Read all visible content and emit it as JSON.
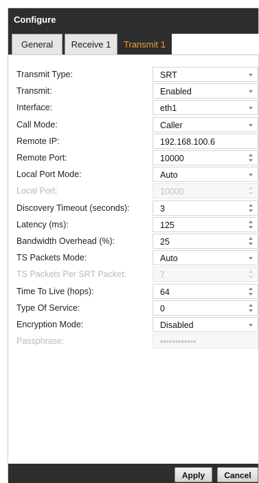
{
  "window": {
    "title": "Configure"
  },
  "tabs": [
    {
      "label": "General"
    },
    {
      "label": "Receive 1"
    },
    {
      "label": "Transmit 1",
      "active": true
    }
  ],
  "colors": {
    "active_tab": "#f39c2a",
    "chrome": "#2e2e2e"
  },
  "fields": [
    {
      "label": "Transmit Type:",
      "value": "SRT",
      "control": "dropdown",
      "disabled": false
    },
    {
      "label": "Transmit:",
      "value": "Enabled",
      "control": "dropdown",
      "disabled": false
    },
    {
      "label": "Interface:",
      "value": "eth1",
      "control": "dropdown",
      "disabled": false
    },
    {
      "label": "Call Mode:",
      "value": "Caller",
      "control": "dropdown",
      "disabled": false
    },
    {
      "label": "Remote IP:",
      "value": "192.168.100.6",
      "control": "text",
      "disabled": false
    },
    {
      "label": "Remote Port:",
      "value": "10000",
      "control": "spinner",
      "disabled": false
    },
    {
      "label": "Local Port Mode:",
      "value": "Auto",
      "control": "dropdown",
      "disabled": false
    },
    {
      "label": "Local Port:",
      "value": "10000",
      "control": "spinner",
      "disabled": true
    },
    {
      "label": "Discovery Timeout (seconds):",
      "value": "3",
      "control": "spinner",
      "disabled": false
    },
    {
      "label": "Latency (ms):",
      "value": "125",
      "control": "spinner",
      "disabled": false
    },
    {
      "label": "Bandwidth Overhead (%):",
      "value": "25",
      "control": "spinner",
      "disabled": false
    },
    {
      "label": "TS Packets Mode:",
      "value": "Auto",
      "control": "dropdown",
      "disabled": false
    },
    {
      "label": "TS Packets Per SRT Packet:",
      "value": "7",
      "control": "spinner",
      "disabled": true
    },
    {
      "label": "Time To Live (hops):",
      "value": "64",
      "control": "spinner",
      "disabled": false
    },
    {
      "label": "Type Of Service:",
      "value": "0",
      "control": "spinner",
      "disabled": false
    },
    {
      "label": "Encryption Mode:",
      "value": "Disabled",
      "control": "dropdown",
      "disabled": false
    },
    {
      "label": "Passphrase:",
      "value": "••••••••••••",
      "control": "password",
      "disabled": true
    }
  ],
  "buttons": {
    "apply": "Apply",
    "cancel": "Cancel"
  }
}
